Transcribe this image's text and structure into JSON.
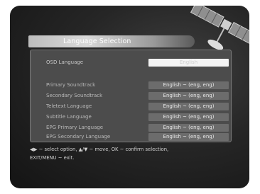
{
  "window": {
    "title": "Language Selection"
  },
  "settings": [
    {
      "label": "OSD Language",
      "value": "English"
    },
    {
      "label": "Primary Soundtrack",
      "value": "English ~ (eng, eng)"
    },
    {
      "label": "Secondary Soundtrack",
      "value": "English ~ (eng, eng)"
    },
    {
      "label": "Teletext Language",
      "value": "English ~ (eng, eng)"
    },
    {
      "label": "Subtitle Language",
      "value": "English ~ (eng, eng)"
    },
    {
      "label": "EPG Primary Language",
      "value": "English ~ (eng, eng)"
    },
    {
      "label": "EPG Secondary Language",
      "value": "English ~ (eng, eng)"
    }
  ],
  "help": {
    "line1": "◀▶ ~ select option, ▲/▼ ~ move, OK ~ confirm selection,",
    "line2": "EXIT/MENU ~ exit."
  }
}
